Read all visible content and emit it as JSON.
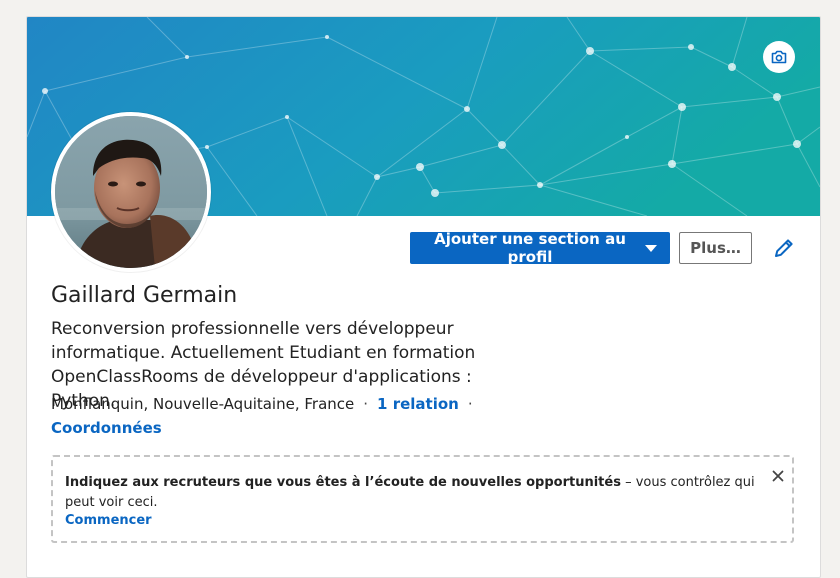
{
  "profile": {
    "name": "Gaillard Germain",
    "headline": "Reconversion professionnelle vers développeur informatique. Actuellement Etudiant en formation OpenClassRooms de développeur d'applications : Python.",
    "location": "Monflanquin, Nouvelle-Aquitaine, France",
    "separator": "·",
    "relations": "1 relation",
    "contact_label": "Coordonnées"
  },
  "actions": {
    "add_section_label": "Ajouter une section au profil",
    "more_label": "Plus…"
  },
  "opportunities": {
    "bold_text": "Indiquez aux recruteurs que vous êtes à l’écoute de nouvelles opportunités",
    "rest_text": " – vous contrôlez qui peut voir ceci.",
    "cta_label": "Commencer"
  },
  "icons": {
    "camera": "camera-icon",
    "edit": "pencil-icon",
    "close": "close-icon",
    "dropdown": "caret-down-icon"
  },
  "colors": {
    "brand_blue": "#0a66c2",
    "banner_start": "#1e88c6",
    "banner_end": "#18aaa8"
  }
}
